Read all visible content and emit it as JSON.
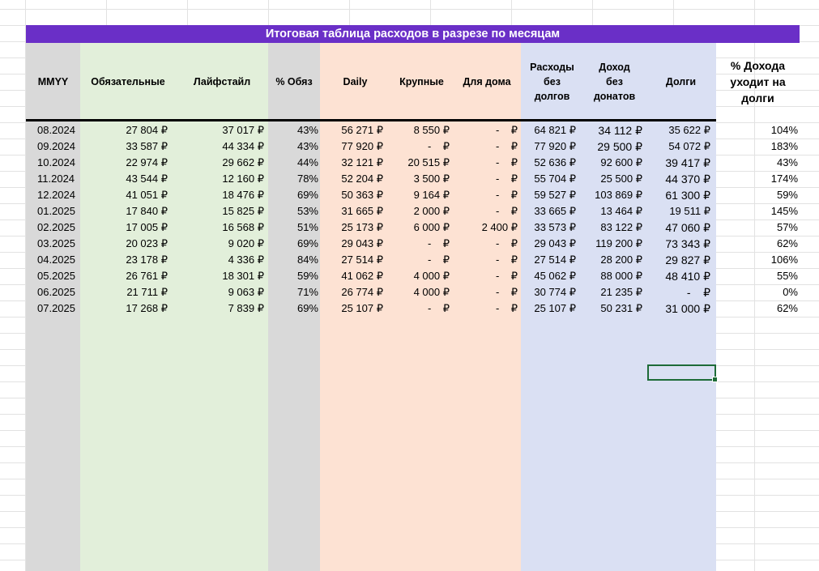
{
  "sheet": {
    "title": "Итоговая таблица расходов в разрезе по месяцам",
    "colors": {
      "title_bar": "#6a2fc7",
      "col_mmyy": "#d9d9d9",
      "col_mandatory": "#e2efda",
      "col_percent_mandatory": "#d9d9d9",
      "col_daily": "#fde2d3",
      "col_summary": "#dae0f3",
      "selection": "#1d6b37"
    },
    "headers": [
      "MMYY",
      "Обязательные",
      "Лайфстайл",
      "% Обяз",
      "Daily",
      "Крупные",
      "Для дома",
      "Расходы\nбез\nдолгов",
      "Доход\nбез\nдонатов",
      "Долги",
      "% Дохода\nуходит на\nдолги"
    ],
    "rows": [
      [
        "08.2024",
        "27 804 ₽",
        "37 017 ₽",
        "43%",
        "56 271 ₽",
        "8 550 ₽",
        "-    ₽",
        "64 821 ₽",
        "34 112 ₽",
        "35 622 ₽",
        "104%"
      ],
      [
        "09.2024",
        "33 587 ₽",
        "44 334 ₽",
        "43%",
        "77 920 ₽",
        "-    ₽",
        "-    ₽",
        "77 920 ₽",
        "29 500 ₽",
        "54 072 ₽",
        "183%"
      ],
      [
        "10.2024",
        "22 974 ₽",
        "29 662 ₽",
        "44%",
        "32 121 ₽",
        "20 515 ₽",
        "-    ₽",
        "52 636 ₽",
        "92 600 ₽",
        "39 417 ₽",
        "43%"
      ],
      [
        "11.2024",
        "43 544 ₽",
        "12 160 ₽",
        "78%",
        "52 204 ₽",
        "3 500 ₽",
        "-    ₽",
        "55 704 ₽",
        "25 500 ₽",
        "44 370 ₽",
        "174%"
      ],
      [
        "12.2024",
        "41 051 ₽",
        "18 476 ₽",
        "69%",
        "50 363 ₽",
        "9 164 ₽",
        "-    ₽",
        "59 527 ₽",
        "103 869 ₽",
        "61 300 ₽",
        "59%"
      ],
      [
        "01.2025",
        "17 840 ₽",
        "15 825 ₽",
        "53%",
        "31 665 ₽",
        "2 000 ₽",
        "-    ₽",
        "33 665 ₽",
        "13 464 ₽",
        "19 511 ₽",
        "145%"
      ],
      [
        "02.2025",
        "17 005 ₽",
        "16 568 ₽",
        "51%",
        "25 173 ₽",
        "6 000 ₽",
        "2 400 ₽",
        "33 573 ₽",
        "83 122 ₽",
        "47 060 ₽",
        "57%"
      ],
      [
        "03.2025",
        "20 023 ₽",
        "9 020 ₽",
        "69%",
        "29 043 ₽",
        "-    ₽",
        "-    ₽",
        "29 043 ₽",
        "119 200 ₽",
        "73 343 ₽",
        "62%"
      ],
      [
        "04.2025",
        "23 178 ₽",
        "4 336 ₽",
        "84%",
        "27 514 ₽",
        "-    ₽",
        "-    ₽",
        "27 514 ₽",
        "28 200 ₽",
        "29 827 ₽",
        "106%"
      ],
      [
        "05.2025",
        "26 761 ₽",
        "18 301 ₽",
        "59%",
        "41 062 ₽",
        "4 000 ₽",
        "-    ₽",
        "45 062 ₽",
        "88 000 ₽",
        "48 410 ₽",
        "55%"
      ],
      [
        "06.2025",
        "21 711 ₽",
        "9 063 ₽",
        "71%",
        "26 774 ₽",
        "4 000 ₽",
        "-    ₽",
        "30 774 ₽",
        "21 235 ₽",
        "-    ₽",
        "0%"
      ],
      [
        "07.2025",
        "17 268 ₽",
        "7 839 ₽",
        "69%",
        "25 107 ₽",
        "-    ₽",
        "-    ₽",
        "25 107 ₽",
        "50 231 ₽",
        "31 000 ₽",
        "62%"
      ]
    ]
  }
}
